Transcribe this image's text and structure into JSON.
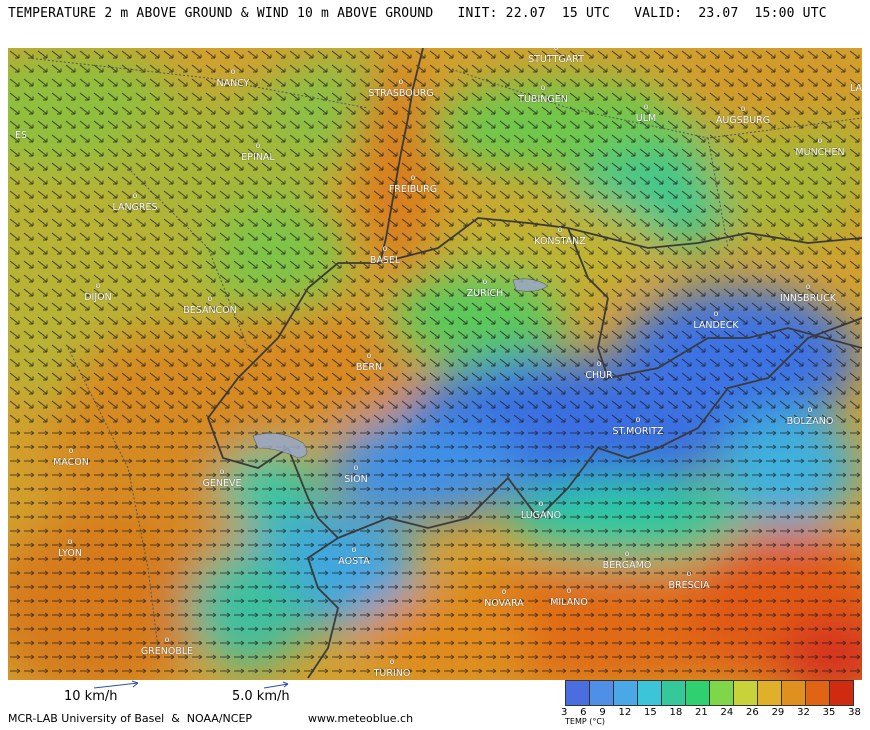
{
  "header": {
    "title": "TEMPERATURE 2 m ABOVE GROUND & WIND 10 m ABOVE GROUND",
    "init": "INIT: 22.07  15 UTC",
    "valid": "VALID:  23.07  15:00 UTC"
  },
  "cities": [
    {
      "name": "STUTTGART"
    },
    {
      "name": "NANCY"
    },
    {
      "name": "STRASBOURG"
    },
    {
      "name": "TUBINGEN"
    },
    {
      "name": "ULM"
    },
    {
      "name": "AUGSBURG"
    },
    {
      "name": "MUNCHEN"
    },
    {
      "name": "EPINAL"
    },
    {
      "name": "FREIBURG"
    },
    {
      "name": "LANGRES"
    },
    {
      "name": "KONSTANZ"
    },
    {
      "name": "BASEL"
    },
    {
      "name": "DIJON"
    },
    {
      "name": "BESANCON"
    },
    {
      "name": "ZURICH"
    },
    {
      "name": "INNSBRUCK"
    },
    {
      "name": "LANDECK"
    },
    {
      "name": "BERN"
    },
    {
      "name": "CHUR"
    },
    {
      "name": "BOLZANO"
    },
    {
      "name": "ST.MORITZ"
    },
    {
      "name": "MACON"
    },
    {
      "name": "GENEVE"
    },
    {
      "name": "SION"
    },
    {
      "name": "LUGANO"
    },
    {
      "name": "LYON"
    },
    {
      "name": "AOSTA"
    },
    {
      "name": "BERGAMO"
    },
    {
      "name": "BRESCIA"
    },
    {
      "name": "NOVARA"
    },
    {
      "name": "MILANO"
    },
    {
      "name": "GRENOBLE"
    },
    {
      "name": "TURINO"
    }
  ],
  "edge_labels": {
    "left": "ES",
    "right": "LA"
  },
  "reference": {
    "wind1": "10 km/h",
    "wind2": "5.0 km/h"
  },
  "footer": {
    "credits": "MCR-LAB University of Basel  &  NOAA/NCEP",
    "site": "www.meteoblue.ch"
  },
  "legend": {
    "label": "TEMP (°C)",
    "ticks": [
      "3",
      "6",
      "9",
      "12",
      "15",
      "18",
      "21",
      "24",
      "26",
      "29",
      "32",
      "35",
      "38"
    ],
    "colors": [
      "#4a6ee0",
      "#4f8fe8",
      "#4aa8e8",
      "#3cc4d8",
      "#35c89a",
      "#2fd070",
      "#7fd64a",
      "#c8d33a",
      "#e0b02a",
      "#e0901e",
      "#e06414",
      "#d02a10"
    ]
  }
}
